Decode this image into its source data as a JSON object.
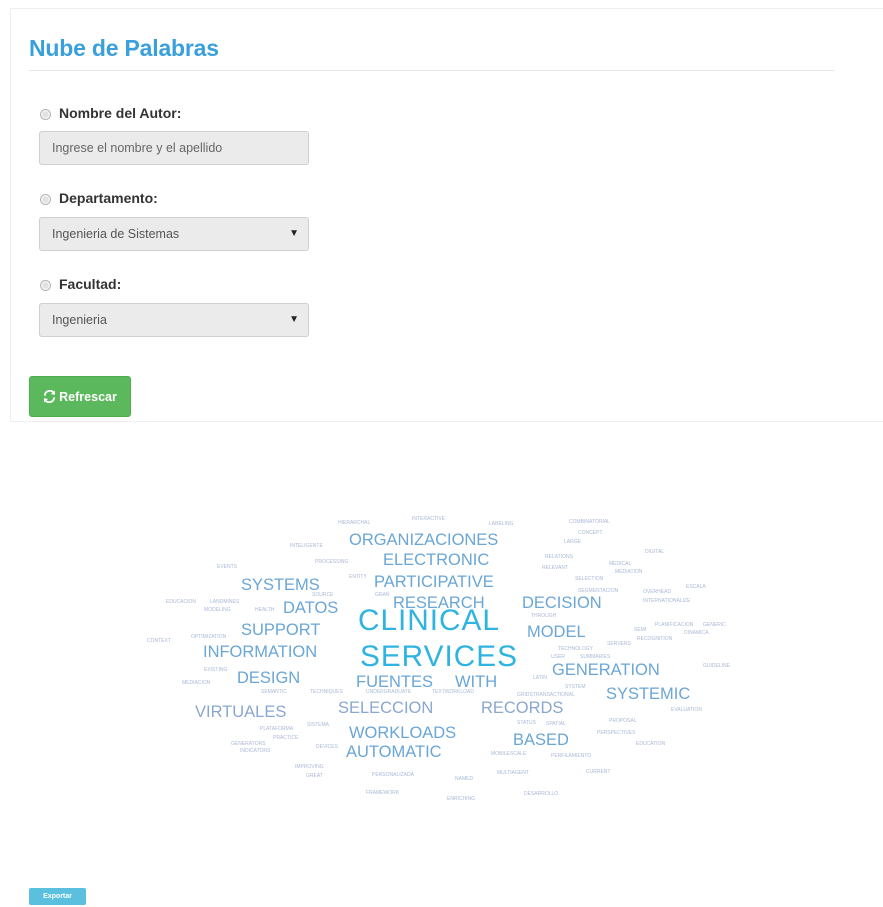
{
  "form": {
    "title": "Nube de Palabras",
    "author": {
      "label": "Nombre del Autor:",
      "placeholder": "Ingrese el nombre y el apellido",
      "value": ""
    },
    "department": {
      "label": "Departamento:",
      "selected": "Ingenieria de Sistemas"
    },
    "faculty": {
      "label": "Facultad:",
      "selected": "Ingenieria"
    },
    "refresh_label": "Refrescar",
    "refresh_icon": "refresh-icon"
  },
  "cloud": {
    "colors": [
      "#2fb3e0",
      "#6aa6d6",
      "#8aa7d0",
      "#7f9cc6",
      "#aab9d6",
      "#c5cde0"
    ],
    "words": [
      {
        "text": "CLINICAL",
        "weight": 32
      },
      {
        "text": "SERVICES",
        "weight": 32
      },
      {
        "text": "ORGANIZACIONES",
        "weight": 17
      },
      {
        "text": "ELECTRONIC",
        "weight": 17
      },
      {
        "text": "SYSTEMS",
        "weight": 17
      },
      {
        "text": "PARTICIPATIVE",
        "weight": 17
      },
      {
        "text": "RESEARCH",
        "weight": 17
      },
      {
        "text": "DECISION",
        "weight": 17
      },
      {
        "text": "DATOS",
        "weight": 17
      },
      {
        "text": "SUPPORT",
        "weight": 17
      },
      {
        "text": "MODEL",
        "weight": 17
      },
      {
        "text": "INFORMATION",
        "weight": 17
      },
      {
        "text": "GENERATION",
        "weight": 17
      },
      {
        "text": "DESIGN",
        "weight": 17
      },
      {
        "text": "FUENTES",
        "weight": 17
      },
      {
        "text": "WITH",
        "weight": 17
      },
      {
        "text": "SYSTEMIC",
        "weight": 17
      },
      {
        "text": "VIRTUALES",
        "weight": 17
      },
      {
        "text": "SELECCION",
        "weight": 17
      },
      {
        "text": "RECORDS",
        "weight": 17
      },
      {
        "text": "WORKLOADS",
        "weight": 17
      },
      {
        "text": "BASED",
        "weight": 17
      },
      {
        "text": "AUTOMATIC",
        "weight": 17
      },
      {
        "text": "HIERARCHAL",
        "weight": 5
      },
      {
        "text": "INTERACTIVE",
        "weight": 5
      },
      {
        "text": "LABELING",
        "weight": 5
      },
      {
        "text": "COMBINATORIAL",
        "weight": 5
      },
      {
        "text": "INTELIGENTE",
        "weight": 5
      },
      {
        "text": "CONCEPT",
        "weight": 5
      },
      {
        "text": "LARGE",
        "weight": 5
      },
      {
        "text": "DIGITAL",
        "weight": 5
      },
      {
        "text": "PROCESSING",
        "weight": 5
      },
      {
        "text": "RELATIONS",
        "weight": 5
      },
      {
        "text": "EVENTS",
        "weight": 5
      },
      {
        "text": "MEDICAL",
        "weight": 5
      },
      {
        "text": "RELEVANT",
        "weight": 5
      },
      {
        "text": "MEDIATION",
        "weight": 5
      },
      {
        "text": "ENTITY",
        "weight": 5
      },
      {
        "text": "SELECTION",
        "weight": 5
      },
      {
        "text": "ESCALA",
        "weight": 5
      },
      {
        "text": "SEGMENTACION",
        "weight": 5
      },
      {
        "text": "SOURCE",
        "weight": 5
      },
      {
        "text": "GRAN",
        "weight": 5
      },
      {
        "text": "OVERHEAD",
        "weight": 5
      },
      {
        "text": "EDUCACION",
        "weight": 5
      },
      {
        "text": "LANDMINES",
        "weight": 5
      },
      {
        "text": "INTERNATIONALIZE",
        "weight": 5
      },
      {
        "text": "MODELING",
        "weight": 5
      },
      {
        "text": "HEALTH",
        "weight": 5
      },
      {
        "text": "THROUGH",
        "weight": 5
      },
      {
        "text": "PLANIFICACION",
        "weight": 5
      },
      {
        "text": "GENERIC",
        "weight": 5
      },
      {
        "text": "SEMI",
        "weight": 5
      },
      {
        "text": "DINAMICA",
        "weight": 5
      },
      {
        "text": "CONTEXT",
        "weight": 5
      },
      {
        "text": "OPTIMIZATION",
        "weight": 5
      },
      {
        "text": "RECOGNITION",
        "weight": 5
      },
      {
        "text": "SERVERS",
        "weight": 5
      },
      {
        "text": "TECHNOLOGY",
        "weight": 5
      },
      {
        "text": "USER",
        "weight": 5
      },
      {
        "text": "SUMMARIES",
        "weight": 5
      },
      {
        "text": "EXISTING",
        "weight": 5
      },
      {
        "text": "GUIDELINE",
        "weight": 5
      },
      {
        "text": "MEDIACION",
        "weight": 5
      },
      {
        "text": "LATIN",
        "weight": 5
      },
      {
        "text": "SEMANTIC",
        "weight": 5
      },
      {
        "text": "TECHNIQUES",
        "weight": 5
      },
      {
        "text": "UNDERGRADUATE",
        "weight": 5
      },
      {
        "text": "TEXTWORKLOAD",
        "weight": 5
      },
      {
        "text": "SYSTEM",
        "weight": 5
      },
      {
        "text": "GRIDSTRANSACTIONAL",
        "weight": 5
      },
      {
        "text": "EVALUATION",
        "weight": 5
      },
      {
        "text": "STATUS",
        "weight": 5
      },
      {
        "text": "SPATIAL",
        "weight": 5
      },
      {
        "text": "PROPOSAL",
        "weight": 5
      },
      {
        "text": "PLATAFORMA",
        "weight": 5
      },
      {
        "text": "SISTEMA",
        "weight": 5
      },
      {
        "text": "PERSPECTIVES",
        "weight": 5
      },
      {
        "text": "PRACTICE",
        "weight": 5
      },
      {
        "text": "GENERATORS",
        "weight": 5
      },
      {
        "text": "EDUCATION",
        "weight": 5
      },
      {
        "text": "INDICATORS",
        "weight": 5
      },
      {
        "text": "DEVICES",
        "weight": 5
      },
      {
        "text": "MOBILESCALE",
        "weight": 5
      },
      {
        "text": "PERFILAMIENTO",
        "weight": 5
      },
      {
        "text": "IMPROVING",
        "weight": 5
      },
      {
        "text": "CURRENT",
        "weight": 5
      },
      {
        "text": "MULTIAGENT",
        "weight": 5
      },
      {
        "text": "GREAT",
        "weight": 5
      },
      {
        "text": "PERSONALIZADA",
        "weight": 5
      },
      {
        "text": "NAMED",
        "weight": 5
      },
      {
        "text": "FRAMEWORK",
        "weight": 5
      },
      {
        "text": "DESARROLLO",
        "weight": 5
      },
      {
        "text": "ENRICHING",
        "weight": 5
      }
    ]
  },
  "export_label": "Exportar"
}
